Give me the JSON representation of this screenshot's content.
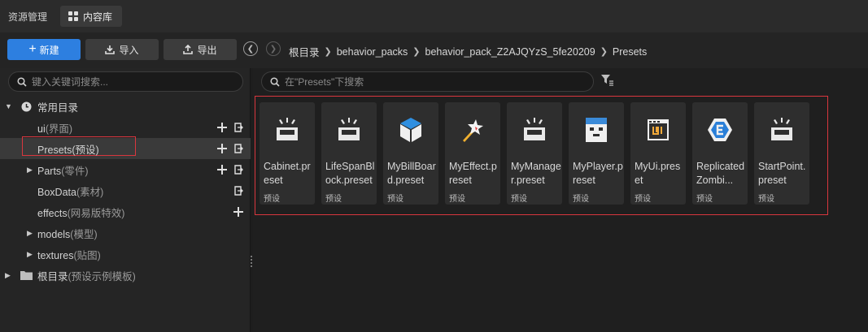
{
  "window": {
    "title": "资源管理",
    "tab_label": "内容库"
  },
  "toolbar": {
    "new_label": "新建",
    "import_label": "导入",
    "export_label": "导出"
  },
  "breadcrumb": [
    "根目录",
    "behavior_packs",
    "behavior_pack_Z2AJQYzS_5fe20209",
    "Presets"
  ],
  "sidebar": {
    "search_placeholder": "键入关键词搜索...",
    "group_label": "常用目录",
    "items": [
      {
        "label": "ui",
        "sub": "(界面)"
      },
      {
        "label": "Presets",
        "sub": "(预设)"
      },
      {
        "label": "Parts",
        "sub": "(零件)"
      },
      {
        "label": "BoxData",
        "sub": "(素材)"
      },
      {
        "label": "effects",
        "sub": "(网易版特效)"
      },
      {
        "label": "models",
        "sub": "(模型)"
      },
      {
        "label": "textures",
        "sub": "(贴图)"
      }
    ],
    "root_label": "根目录",
    "root_sub": "(预设示例模板)"
  },
  "main": {
    "search_placeholder": "在\"Presets\"下搜索",
    "cards": [
      {
        "name": "Cabinet.preset",
        "type": "预设",
        "icon": "preset-tray-icon"
      },
      {
        "name": "LifeSpanBlock.preset",
        "type": "预设",
        "icon": "preset-tray-icon"
      },
      {
        "name": "MyBillBoard.preset",
        "type": "预设",
        "icon": "cube-icon"
      },
      {
        "name": "MyEffect.preset",
        "type": "预设",
        "icon": "magic-wand-icon"
      },
      {
        "name": "MyManager.preset",
        "type": "预设",
        "icon": "preset-tray-icon"
      },
      {
        "name": "MyPlayer.preset",
        "type": "预设",
        "icon": "player-head-icon"
      },
      {
        "name": "MyUi.preset",
        "type": "预设",
        "icon": "ui-window-icon"
      },
      {
        "name": "ReplicatedZombi...",
        "type": "预设",
        "icon": "e-hexagon-icon"
      },
      {
        "name": "StartPoint.preset",
        "type": "预设",
        "icon": "preset-tray-icon"
      }
    ]
  },
  "colors": {
    "accent": "#2d7fe0",
    "highlight_border": "#d9363e",
    "cube_blue": "#2f8fe0"
  }
}
